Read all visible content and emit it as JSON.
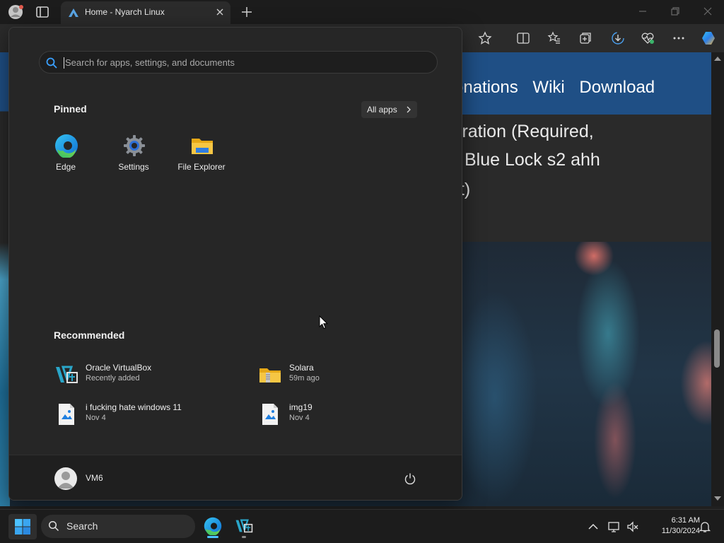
{
  "browser": {
    "tab_title": "Home - Nyarch Linux",
    "window_controls": [
      "minimize-icon",
      "restore-icon",
      "close-icon"
    ],
    "toolbar_icons": [
      "favorite-star-icon",
      "split-screen-icon",
      "favorites-icon",
      "collections-icon",
      "downloads-icon",
      "browser-essentials-icon",
      "more-icon",
      "copilot-icon"
    ]
  },
  "webpage": {
    "nav_links": [
      "onations",
      "Wiki",
      "Download"
    ],
    "body_lines": [
      "leration (Required,",
      "Blue Lock s2 ahh",
      "nt)"
    ]
  },
  "start_menu": {
    "search_placeholder": "Search for apps, settings, and documents",
    "pinned_title": "Pinned",
    "all_apps_label": "All apps",
    "pinned": [
      {
        "label": "Edge",
        "icon": "edge-icon"
      },
      {
        "label": "Settings",
        "icon": "settings-gear-icon"
      },
      {
        "label": "File Explorer",
        "icon": "file-explorer-icon"
      }
    ],
    "recommended_title": "Recommended",
    "recommended": [
      {
        "name": "Oracle VirtualBox",
        "sub": "Recently added",
        "icon": "virtualbox-icon"
      },
      {
        "name": "Solara",
        "sub": "59m ago",
        "icon": "zip-folder-icon"
      },
      {
        "name": "i fucking hate windows 11",
        "sub": "Nov 4",
        "icon": "image-file-icon"
      },
      {
        "name": "img19",
        "sub": "Nov 4",
        "icon": "image-file-icon"
      }
    ],
    "user_name": "VM6"
  },
  "taskbar": {
    "search_label": "Search",
    "time": "6:31 AM",
    "date": "11/30/2024",
    "apps": [
      "edge-icon",
      "virtualbox-icon"
    ]
  },
  "colors": {
    "accent": "#3aa0ff",
    "site_nav": "#1f4f85"
  }
}
